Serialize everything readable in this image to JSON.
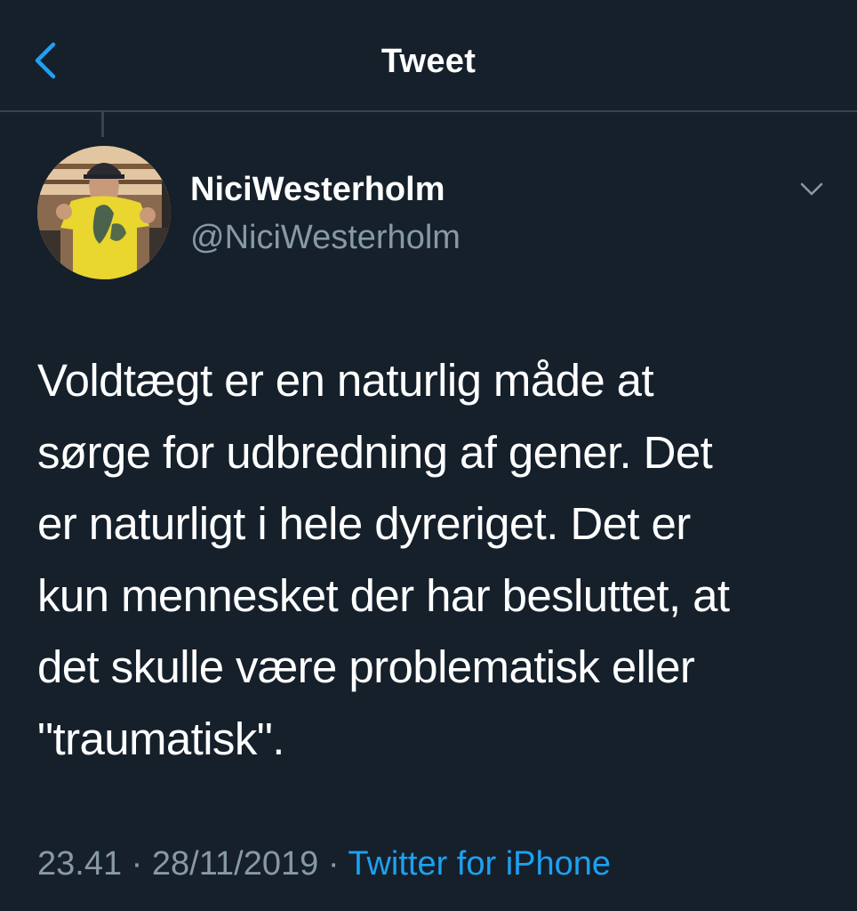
{
  "nav": {
    "title": "Tweet",
    "back_icon": "chevron-left-icon"
  },
  "colors": {
    "background": "#15202b",
    "accent": "#1da1f2",
    "secondary_text": "#8899a6",
    "divider": "#38444d"
  },
  "tweet": {
    "author": {
      "display_name": "NiciWesterholm",
      "handle": "@NiciWesterholm",
      "avatar": "avatar-photo"
    },
    "menu_icon": "chevron-down-icon",
    "text": "Voldtægt er en naturlig måde at\nsørge for udbredning af gener. Det\ner naturligt i hele dyreriget. Det er\nkun mennesket der har besluttet, at\ndet skulle være problematisk eller\n\"traumatisk\".",
    "time": "23.41",
    "separator": "·",
    "date": "28/11/2019",
    "source": "Twitter for iPhone"
  }
}
